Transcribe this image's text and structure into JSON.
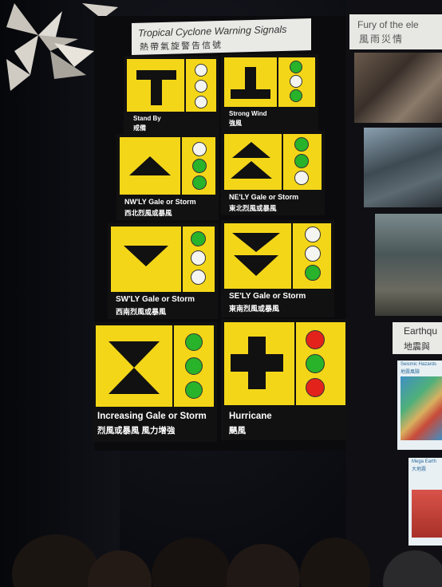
{
  "board_title": {
    "en": "Tropical Cyclone Warning Signals",
    "zh": "熱帶氣旋警告信號"
  },
  "signals": [
    {
      "en": "Stand By",
      "zh": "戒備",
      "symbol": "T-shape",
      "lights": [
        "white",
        "white",
        "white"
      ]
    },
    {
      "en": "Strong Wind",
      "zh": "強風",
      "symbol": "inverted-T",
      "lights": [
        "green",
        "white",
        "green"
      ]
    },
    {
      "en": "NW'LY Gale or Storm",
      "zh": "西北烈風或暴風",
      "symbol": "triangle-up",
      "lights": [
        "white",
        "green",
        "green"
      ]
    },
    {
      "en": "NE'LY Gale or Storm",
      "zh": "東北烈風或暴風",
      "symbol": "double-triangle-up",
      "lights": [
        "green",
        "green",
        "white"
      ]
    },
    {
      "en": "SW'LY Gale or Storm",
      "zh": "西南烈風或暴風",
      "symbol": "triangle-down",
      "lights": [
        "green",
        "white",
        "white"
      ]
    },
    {
      "en": "SE'LY Gale or Storm",
      "zh": "東南烈風或暴風",
      "symbol": "double-triangle-down",
      "lights": [
        "white",
        "white",
        "green"
      ]
    },
    {
      "en": "Increasing Gale or Storm",
      "zh": "烈風或暴風  風力增強",
      "symbol": "hourglass",
      "lights": [
        "green",
        "green",
        "green"
      ]
    },
    {
      "en": "Hurricane",
      "zh": "颶風",
      "symbol": "cross",
      "lights": [
        "red",
        "green",
        "red"
      ]
    }
  ],
  "side_exhibit": {
    "title_en": "Fury of the ele",
    "title_zh": "風雨災情"
  },
  "earthquake_exhibit": {
    "title_en": "Earthqu",
    "title_zh": "地震與",
    "poster1_caption_en": "Seismic Hazards",
    "poster1_caption_zh": "地震風險",
    "poster2_caption_en": "Mega Earth",
    "poster2_caption_zh": "大地震"
  },
  "colors": {
    "sign_yellow": "#f4d619",
    "light_green": "#28b32a",
    "light_red": "#e3231b",
    "light_white": "#f4f4f0"
  }
}
